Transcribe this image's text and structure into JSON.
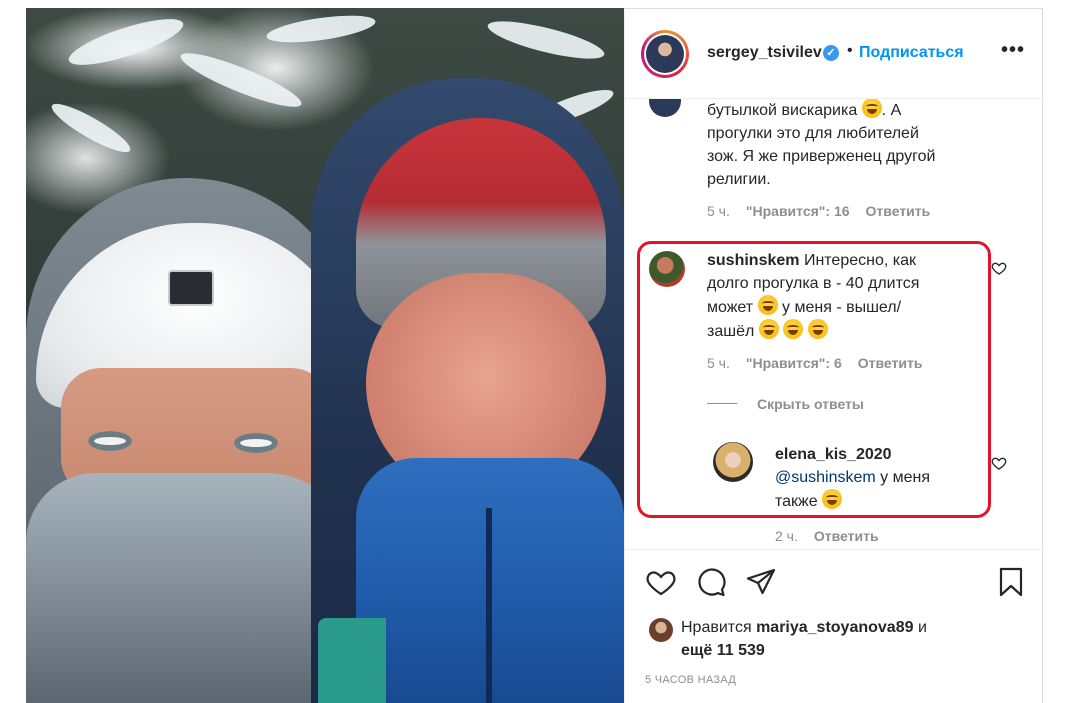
{
  "post": {
    "username": "sergey_tsivilev",
    "follow_label": "Подписаться",
    "more_label": "•••",
    "dot": "•",
    "verified_mark": "✓"
  },
  "comments": [
    {
      "user": "",
      "text_lines": [
        "бутылкой вискарика",
        ". А",
        "прогулки это для любителей",
        "зож. Я же приверженец другой",
        "религии."
      ],
      "time": "5 ч.",
      "likes": "\"Нравится\": 16",
      "reply": "Ответить"
    },
    {
      "user": "sushinskem",
      "text_a": "Интересно, как",
      "text_b": "долго прогулка в - 40 длится",
      "text_c": "может",
      "text_d": "у меня - вышел/",
      "text_e": "зашёл",
      "time": "5 ч.",
      "likes": "\"Нравится\": 6",
      "reply": "Ответить",
      "hide_replies": "Скрыть ответы"
    },
    {
      "user": "elena_kis_2020",
      "mention": "@sushinskem",
      "text_a": "у меня",
      "text_b": "также",
      "time": "2 ч.",
      "reply": "Ответить"
    }
  ],
  "likes": {
    "prefix": "Нравится",
    "user": "mariya_stoyanova89",
    "conj": "и",
    "others": "ещё 11 539"
  },
  "time_ago": "5 ЧАСОВ НАЗАД",
  "icons": {
    "heart": "heart-icon",
    "comment": "comment-icon",
    "share": "share-icon",
    "save": "bookmark-icon"
  },
  "colors": {
    "link_blue": "#0095f6",
    "highlight_red": "#e3142a",
    "meta_gray": "#8e8e8e"
  }
}
